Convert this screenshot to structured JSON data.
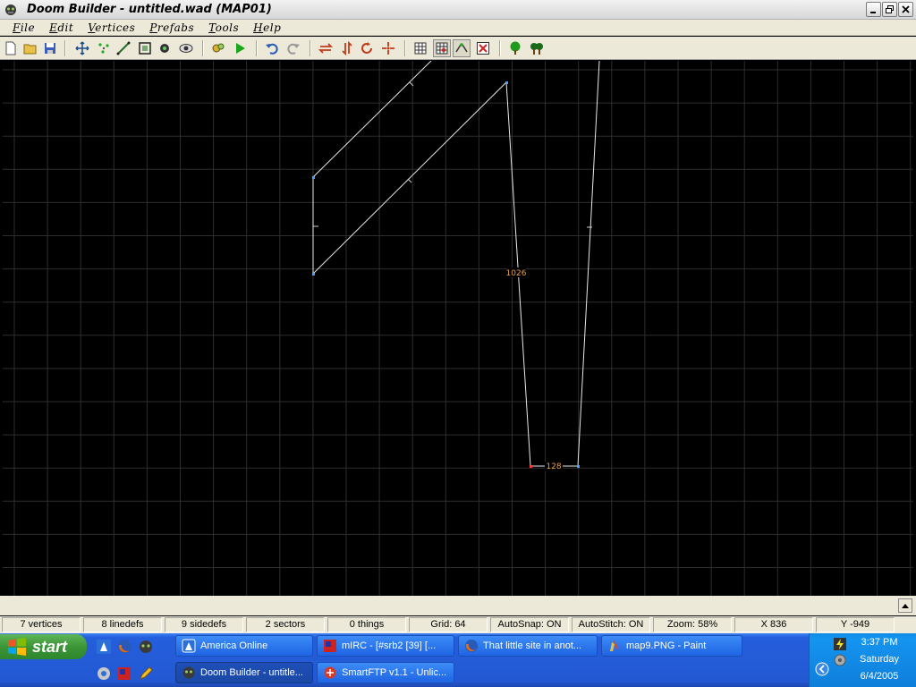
{
  "window": {
    "title": "Doom Builder - untitled.wad (MAP01)"
  },
  "menu": {
    "items": [
      {
        "label": "File"
      },
      {
        "label": "Edit"
      },
      {
        "label": "Vertices"
      },
      {
        "label": "Prefabs"
      },
      {
        "label": "Tools"
      },
      {
        "label": "Help"
      }
    ]
  },
  "toolbar": {
    "buttons": [
      "new-file-icon",
      "open-folder-icon",
      "save-icon",
      "move-mode-icon",
      "vertices-mode-icon",
      "linedefs-mode-icon",
      "sectors-mode-icon",
      "things-mode-icon",
      "3d-mode-icon",
      "build-nodes-icon",
      "test-map-icon",
      "undo-icon",
      "redo-icon",
      "flip-horizontal-icon",
      "flip-vertical-icon",
      "rotate-icon",
      "scale-icon",
      "grid-toggle-icon",
      "snap-grid-icon",
      "stitch-icon",
      "close-map-icon",
      "tree-green-icon",
      "tree-dark-icon"
    ]
  },
  "map": {
    "labels": {
      "long_line_length": "1026",
      "short_line_length": "128"
    }
  },
  "status": {
    "vertices": "7 vertices",
    "linedefs": "8 linedefs",
    "sidedefs": "9 sidedefs",
    "sectors": "2 sectors",
    "things": "0 things",
    "grid": "Grid: 64",
    "autosnap": "AutoSnap: ON",
    "autostitch": "AutoStitch: ON",
    "zoom": "Zoom: 58%",
    "x": "X 836",
    "y": "Y -949"
  },
  "taskbar": {
    "start_label": "start",
    "tasks_row1": [
      {
        "label": "America  Online"
      },
      {
        "label": "mIRC - [#srb2 [39] [..."
      },
      {
        "label": "That little site in anot..."
      },
      {
        "label": "map9.PNG - Paint"
      }
    ],
    "tasks_row2": [
      {
        "label": "Doom Builder - untitle..."
      },
      {
        "label": "SmartFTP v1.1 - Unlic..."
      }
    ],
    "clock": {
      "time": "3:37 PM",
      "day": "Saturday",
      "date": "6/4/2005"
    }
  }
}
